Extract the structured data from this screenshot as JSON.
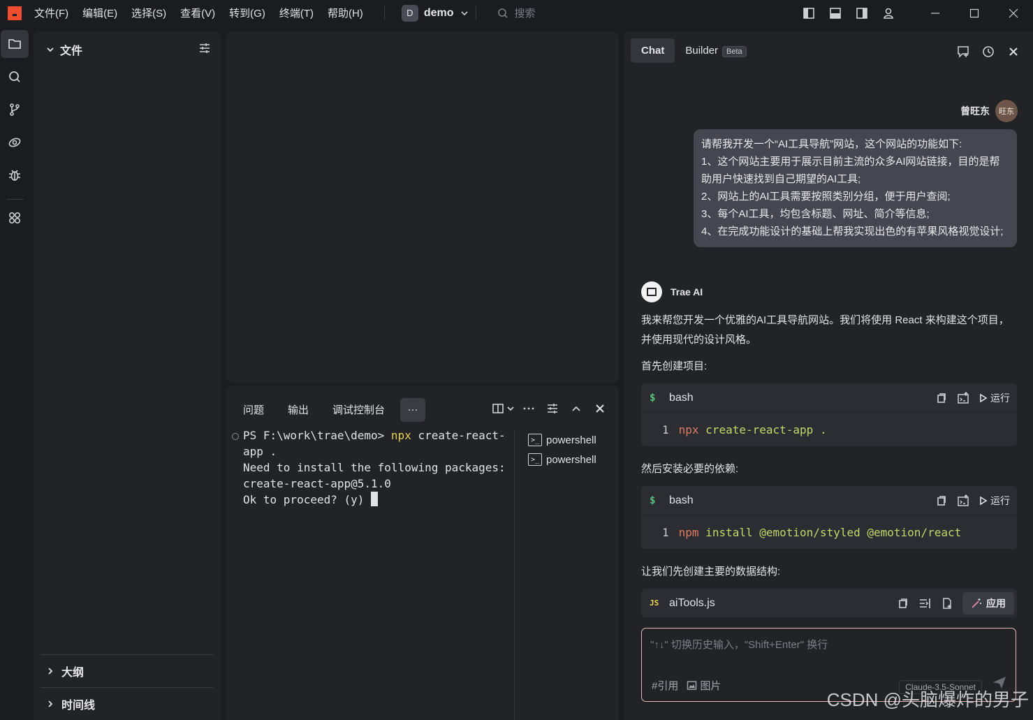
{
  "menu": [
    "文件(F)",
    "编辑(E)",
    "选择(S)",
    "查看(V)",
    "转到(G)",
    "终端(T)",
    "帮助(H)"
  ],
  "project": {
    "badge": "D",
    "name": "demo"
  },
  "search": {
    "placeholder": "搜索"
  },
  "explorer": {
    "title": "文件",
    "sections": [
      "大纲",
      "时间线"
    ]
  },
  "panel": {
    "tabs": [
      "问题",
      "输出",
      "调试控制台"
    ],
    "more_label": "···",
    "terminal": {
      "prompt": "PS F:\\work\\trae\\demo> ",
      "cmd": "npx",
      "args": " create-react-app .",
      "lines": [
        "Need to install the following packages:",
        "create-react-app@5.1.0",
        "Ok to proceed? (y) "
      ]
    },
    "shells": [
      "powershell",
      "powershell"
    ]
  },
  "chat": {
    "tabs": {
      "chat": "Chat",
      "builder": "Builder",
      "beta": "Beta"
    },
    "user": {
      "name": "曾旺东",
      "avatar": "旺东"
    },
    "user_message": [
      "请帮我开发一个“AI工具导航”网站，这个网站的功能如下:",
      "1、这个网站主要用于展示目前主流的众多AI网站链接，目的是帮助用户快速找到自己期望的AI工具;",
      "2、网站上的AI工具需要按照类别分组，便于用户查阅;",
      "3、每个AI工具，均包含标题、网址、简介等信息;",
      "4、在完成功能设计的基础上帮我实现出色的有苹果风格视觉设计;"
    ],
    "ai": {
      "name": "Trae AI",
      "intro": "我来帮您开发一个优雅的AI工具导航网站。我们将使用 React 来构建这个项目，并使用现代的设计风格。",
      "step1": "首先创建项目:",
      "step2": "然后安装必要的依赖:",
      "step3": "让我们先创建主要的数据结构:",
      "run_label": "运行",
      "apply_label": "应用",
      "code1": {
        "lang": "bash",
        "icon": "$",
        "line_no": "1",
        "kw": "npx",
        "rest": " create-react-app ."
      },
      "code2": {
        "lang": "bash",
        "icon": "$",
        "line_no": "1",
        "kw": "npm",
        "rest": " install @emotion/styled @emotion/react"
      },
      "code3": {
        "lang": "aiTools.js",
        "icon": "JS"
      }
    },
    "input": {
      "placeholder": "\"↑↓\" 切换历史输入，\"Shift+Enter\" 换行",
      "ref_label": "#引用",
      "image_label": "图片",
      "model": "Claude-3.5-Sonnet"
    }
  },
  "watermark": "CSDN @头脑爆炸的男子"
}
